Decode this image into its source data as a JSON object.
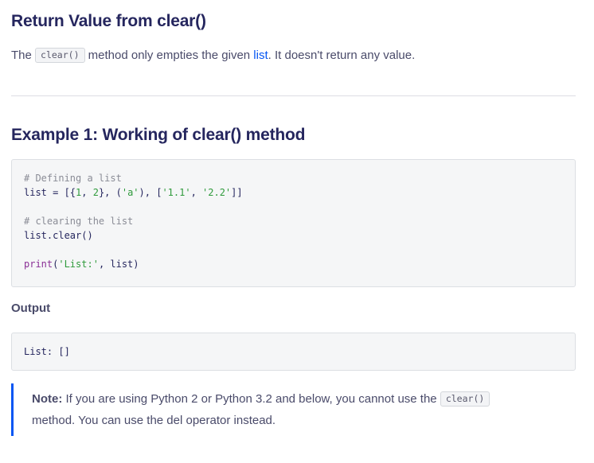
{
  "section1": {
    "title": "Return Value from clear()",
    "intro_prefix": "The",
    "intro_code": "clear()",
    "intro_middle": "method only empties the given",
    "intro_link": "list",
    "intro_suffix": ". It doesn't return any value."
  },
  "section2": {
    "title": "Example 1: Working of clear() method",
    "code": {
      "line1": "# Defining a list",
      "line2_var": "list = [{",
      "line2_n1": "1",
      "line2_sep1": ", ",
      "line2_n2": "2",
      "line2_sep2": "}, (",
      "line2_s1": "'a'",
      "line2_sep3": "), [",
      "line2_s2": "'1.1'",
      "line2_sep4": ", ",
      "line2_s3": "'2.2'",
      "line2_end": "]]",
      "line4": "# clearing the list",
      "line5": "list.clear()",
      "line7_fn": "print",
      "line7_open": "(",
      "line7_str": "'List:'",
      "line7_rest": ", list)"
    },
    "output_label": "Output",
    "output_text": "List: []"
  },
  "note": {
    "label": "Note:",
    "text_before": " If you are using Python 2 or Python 3.2 and below, you cannot use the ",
    "code": "clear()",
    "text_after": "method. You can use the del operator instead."
  }
}
